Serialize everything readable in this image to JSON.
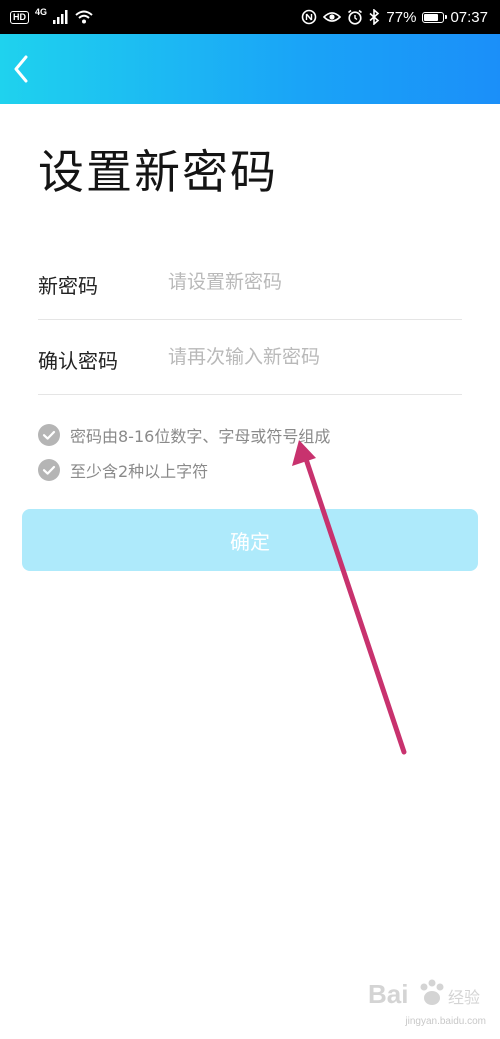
{
  "status_bar": {
    "hd": "HD",
    "network": "4G",
    "battery_percent": "77%",
    "battery_level": 0.77,
    "time": "07:37",
    "icons": [
      "signal-icon",
      "wifi-icon",
      "nfc-icon",
      "eye-icon",
      "alarm-icon",
      "bluetooth-icon",
      "battery-icon"
    ]
  },
  "header": {
    "back_icon": "chevron-left-icon",
    "gradient": [
      "#1fd2ee",
      "#1b8ff9"
    ]
  },
  "page": {
    "title": "设置新密码"
  },
  "form": {
    "new_password": {
      "label": "新密码",
      "placeholder": "请设置新密码",
      "value": ""
    },
    "confirm_password": {
      "label": "确认密码",
      "placeholder": "请再次输入新密码",
      "value": ""
    }
  },
  "rules": [
    {
      "text": "密码由8-16位数字、字母或符号组成",
      "icon": "check-circle-icon"
    },
    {
      "text": "至少含2种以上字符",
      "icon": "check-circle-icon"
    }
  ],
  "confirm_button": {
    "label": "确定",
    "bg_color": "#aeeafb"
  },
  "annotation": {
    "color": "#c8326e"
  },
  "watermark": {
    "brand": "Bai",
    "brand2": "经验",
    "url": "jingyan.baidu.com"
  }
}
